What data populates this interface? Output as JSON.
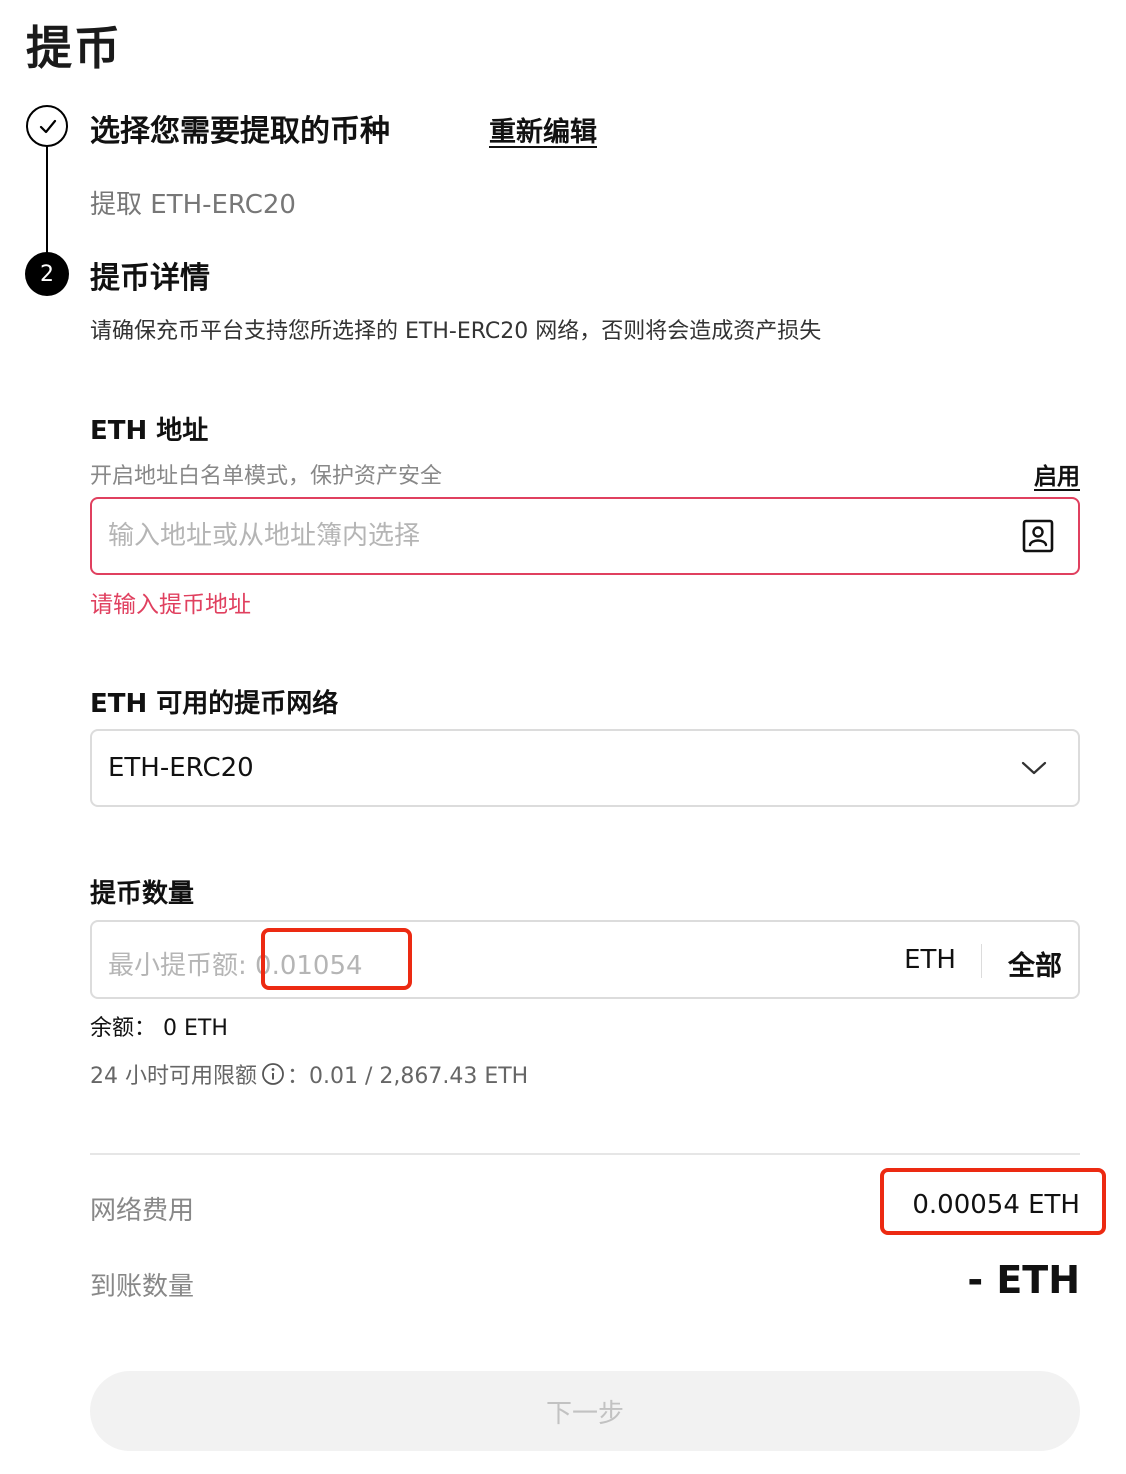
{
  "page": {
    "title": "提币"
  },
  "step1": {
    "title": "选择您需要提取的币种",
    "edit_label": "重新编辑",
    "summary": "提取 ETH-ERC20"
  },
  "step2": {
    "number": "2",
    "title": "提币详情",
    "description": "请确保充币平台支持您所选择的 ETH-ERC20 网络，否则将会造成资产损失"
  },
  "address": {
    "label": "ETH 地址",
    "whitelist_text": "开启地址白名单模式，保护资产安全",
    "enable_label": "启用",
    "placeholder": "输入地址或从地址簿内选择",
    "value": "",
    "error": "请输入提币地址",
    "book_icon": "address-book-icon"
  },
  "network": {
    "label": "ETH 可用的提币网络",
    "selected": "ETH-ERC20"
  },
  "amount": {
    "label": "提币数量",
    "placeholder_prefix": "最小提币额: ",
    "placeholder_min": "0.01054",
    "unit": "ETH",
    "all_label": "全部",
    "balance_label": "余额：",
    "balance_value": "0 ETH",
    "limit_label": "24 小时可用限额",
    "limit_value": "：0.01 / 2,867.43 ETH"
  },
  "summary": {
    "fee_label": "网络费用",
    "fee_value": "0.00054 ETH",
    "receive_label": "到账数量",
    "receive_value": "- ETH"
  },
  "next_button": {
    "label": "下一步"
  },
  "colors": {
    "error": "#e0405f",
    "highlight": "#ec2a12",
    "button_bg": "#f2f2f2",
    "button_text": "#c2c2c2"
  }
}
